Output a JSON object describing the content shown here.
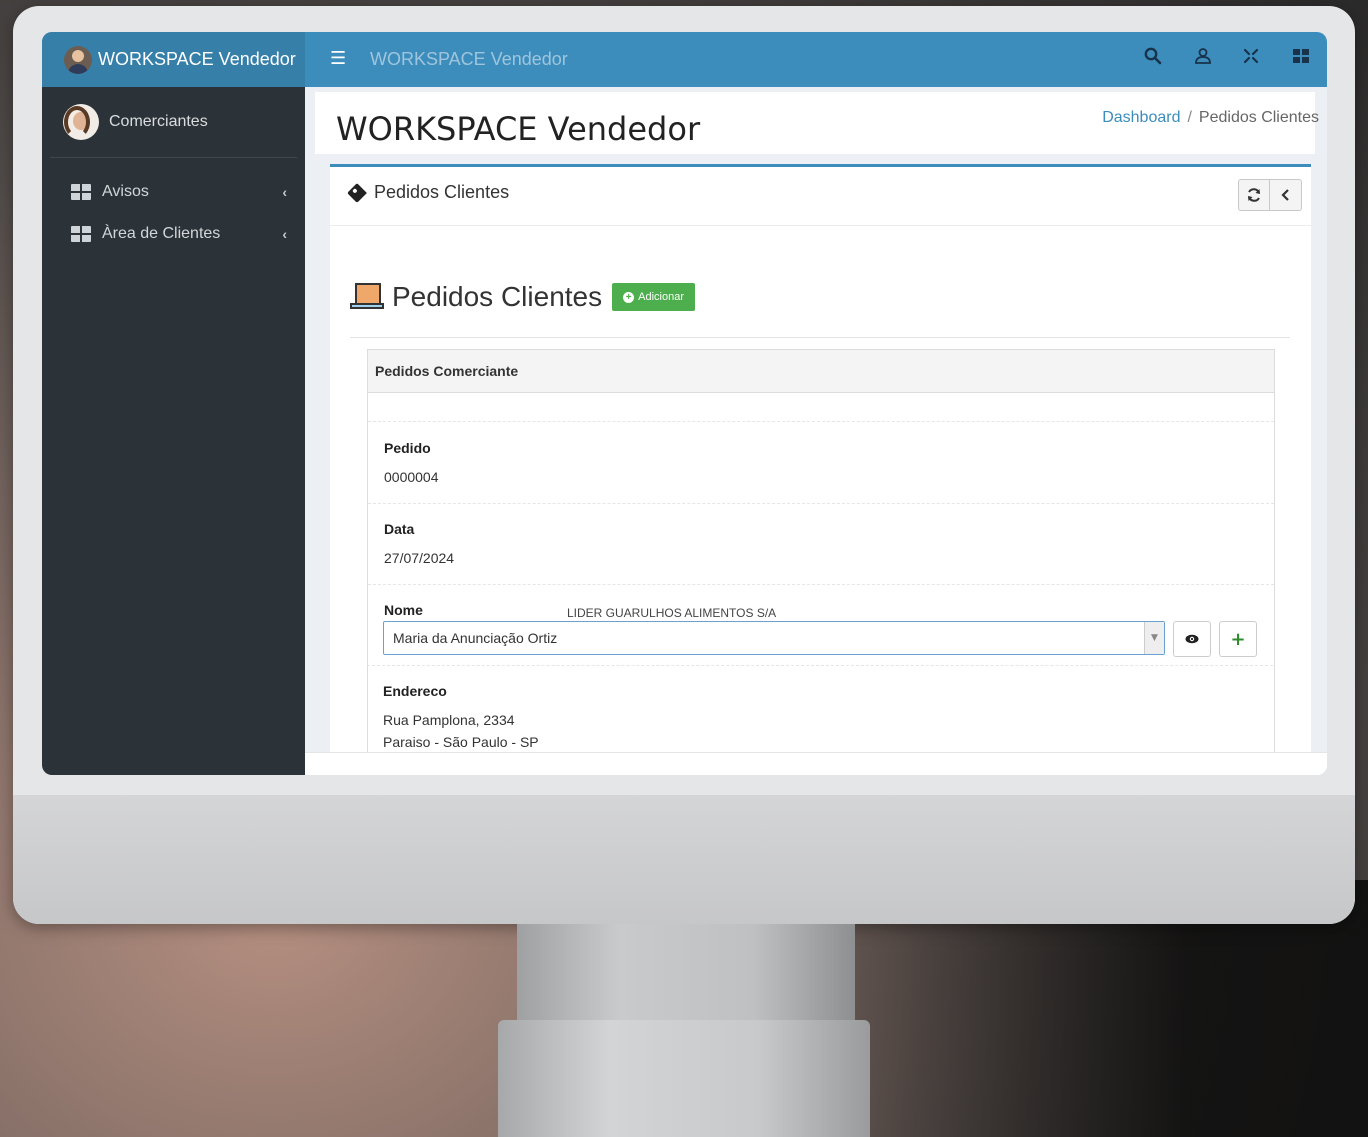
{
  "topbar": {
    "brand": "WORKSPACE Vendedor",
    "title": "WORKSPACE Vendedor"
  },
  "sidebar": {
    "user": "Comerciantes",
    "items": [
      {
        "label": "Avisos"
      },
      {
        "label": "Àrea de Clientes"
      }
    ]
  },
  "header": {
    "title": "WORKSPACE Vendedor",
    "breadcrumb": {
      "home": "Dashboard",
      "sep": "/",
      "current": "Pedidos Clientes"
    }
  },
  "box": {
    "title": "Pedidos Clientes",
    "section_title": "Pedidos Clientes",
    "add_label": "Adicionar",
    "panel_title": "Pedidos Comerciante"
  },
  "form": {
    "pedido_label": "Pedido",
    "pedido_value": "0000004",
    "data_label": "Data",
    "data_value": "27/07/2024",
    "nome_label": "Nome",
    "nome_company": "LIDER GUARULHOS ALIMENTOS S/A",
    "nome_selected": "Maria da Anunciação Ortiz",
    "endereco_label": "Endereco",
    "endereco_line1": "Rua Pamplona, 2334",
    "endereco_line2": "Paraiso - São Paulo - SP"
  },
  "colors": {
    "primary": "#3c8dbc",
    "success": "#4cae4c",
    "sidebar": "#2c3338"
  }
}
